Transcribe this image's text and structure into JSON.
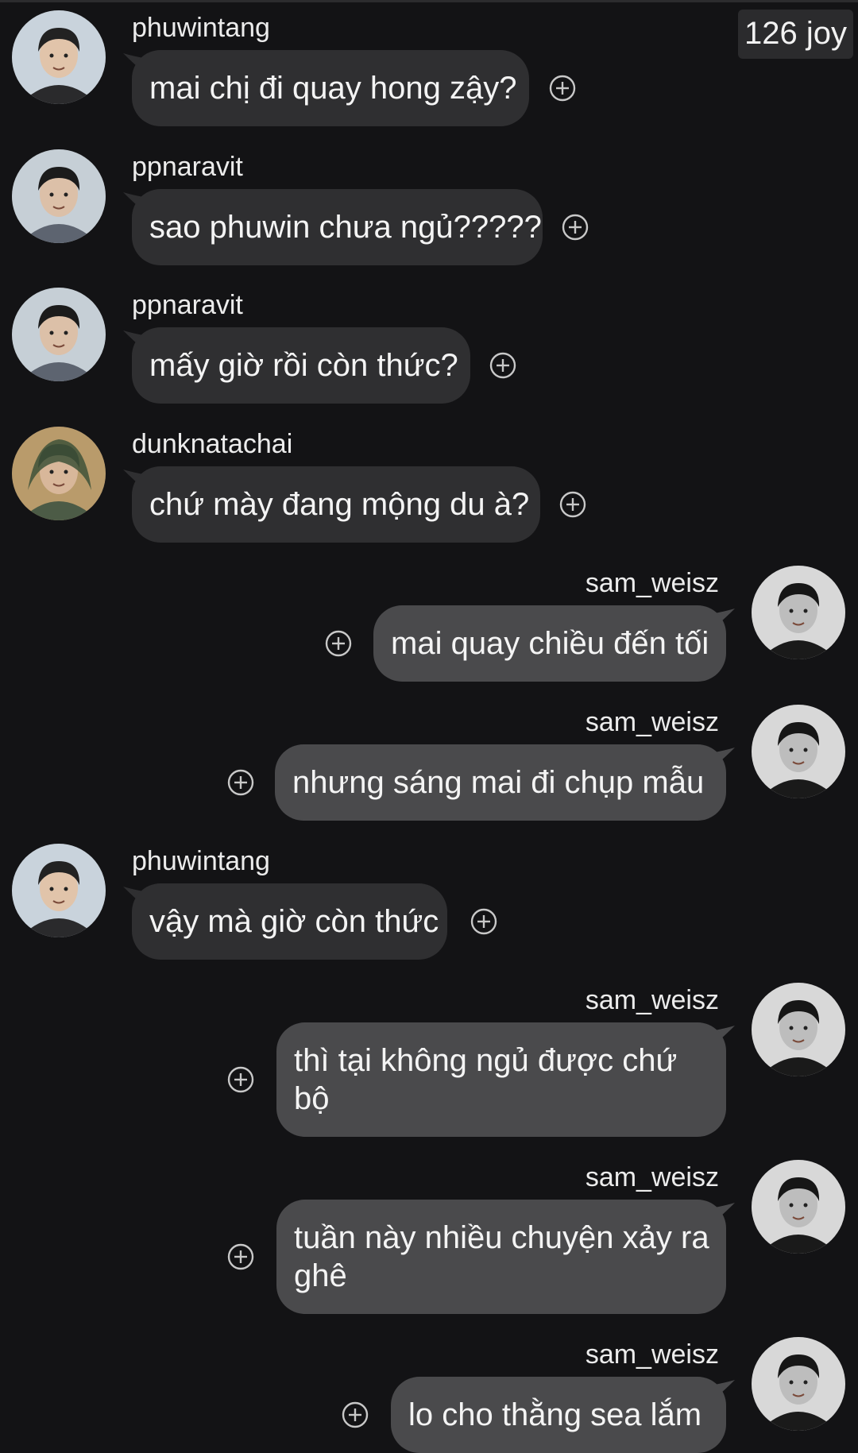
{
  "badge": {
    "label": "126 joy"
  },
  "messages": [
    {
      "side": "left",
      "user": "phuwintang",
      "avatar": "avatar-phuwintang",
      "lines": [
        "mai chị đi quay hong zậy?"
      ]
    },
    {
      "side": "left",
      "user": "ppnaravit",
      "avatar": "avatar-ppnaravit",
      "lines": [
        "sao phuwin chưa ngủ?????"
      ]
    },
    {
      "side": "left",
      "user": "ppnaravit",
      "avatar": "avatar-ppnaravit",
      "lines": [
        "mấy giờ rồi còn thức?"
      ]
    },
    {
      "side": "left",
      "user": "dunknatachai",
      "avatar": "avatar-dunknatachai",
      "lines": [
        "chứ mày đang mộng du à?"
      ]
    },
    {
      "side": "right",
      "user": "sam_weisz",
      "avatar": "avatar-sam-weisz",
      "lines": [
        "mai quay chiều đến tối"
      ]
    },
    {
      "side": "right",
      "user": "sam_weisz",
      "avatar": "avatar-sam-weisz",
      "lines": [
        "nhưng sáng mai đi chụp mẫu"
      ]
    },
    {
      "side": "left",
      "user": "phuwintang",
      "avatar": "avatar-phuwintang",
      "lines": [
        "vậy mà giờ còn thức"
      ]
    },
    {
      "side": "right",
      "user": "sam_weisz",
      "avatar": "avatar-sam-weisz",
      "lines": [
        "thì tại không ngủ được chứ",
        "bộ"
      ]
    },
    {
      "side": "right",
      "user": "sam_weisz",
      "avatar": "avatar-sam-weisz",
      "lines": [
        "tuần này nhiều chuyện xảy ra",
        "ghê"
      ]
    },
    {
      "side": "right",
      "user": "sam_weisz",
      "avatar": "avatar-sam-weisz",
      "lines": [
        "lo cho thằng sea lắm"
      ]
    }
  ],
  "colors": {
    "background": "#131315",
    "bubble_incoming": "#2f2f31",
    "bubble_outgoing": "#4a4a4c",
    "text": "#f4f4f4",
    "plus_icon": "#c8c8c8"
  },
  "icons": {
    "react": "plus-circle-icon"
  }
}
